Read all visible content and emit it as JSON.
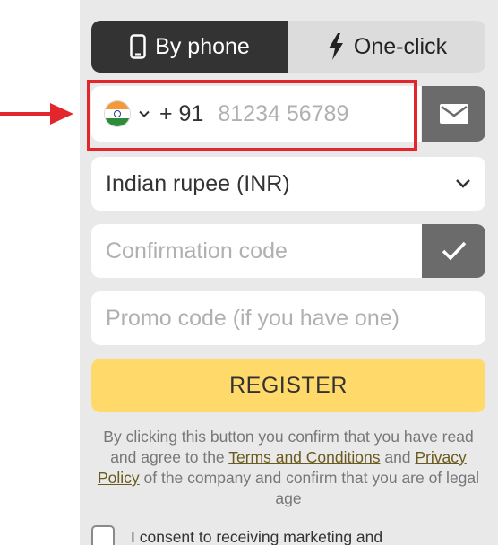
{
  "tabs": {
    "by_phone": "By phone",
    "one_click": "One-click"
  },
  "phone": {
    "country_flag": "india-flag-icon",
    "dial_code": "+ 91",
    "placeholder": "81234 56789"
  },
  "currency": {
    "selected": "Indian rupee (INR)"
  },
  "confirmation": {
    "placeholder": "Confirmation code"
  },
  "promo": {
    "placeholder": "Promo code (if you have one)"
  },
  "register": {
    "label": "REGISTER"
  },
  "disclaimer": {
    "part1": "By clicking this button you confirm that you have read and agree to the ",
    "terms_link": "Terms and Conditions",
    "part2": " and ",
    "privacy_link": "Privacy Policy",
    "part3": " of the company and confirm that you are of legal age"
  },
  "consent": {
    "text": "I consent to receiving marketing and"
  },
  "colors": {
    "active_tab": "#333333",
    "inactive_tab": "#dcdcdc",
    "panel_bg": "#e9e9e9",
    "register_bg": "#ffd969",
    "annotation_red": "#e3262b",
    "link": "#6b5a1e"
  }
}
